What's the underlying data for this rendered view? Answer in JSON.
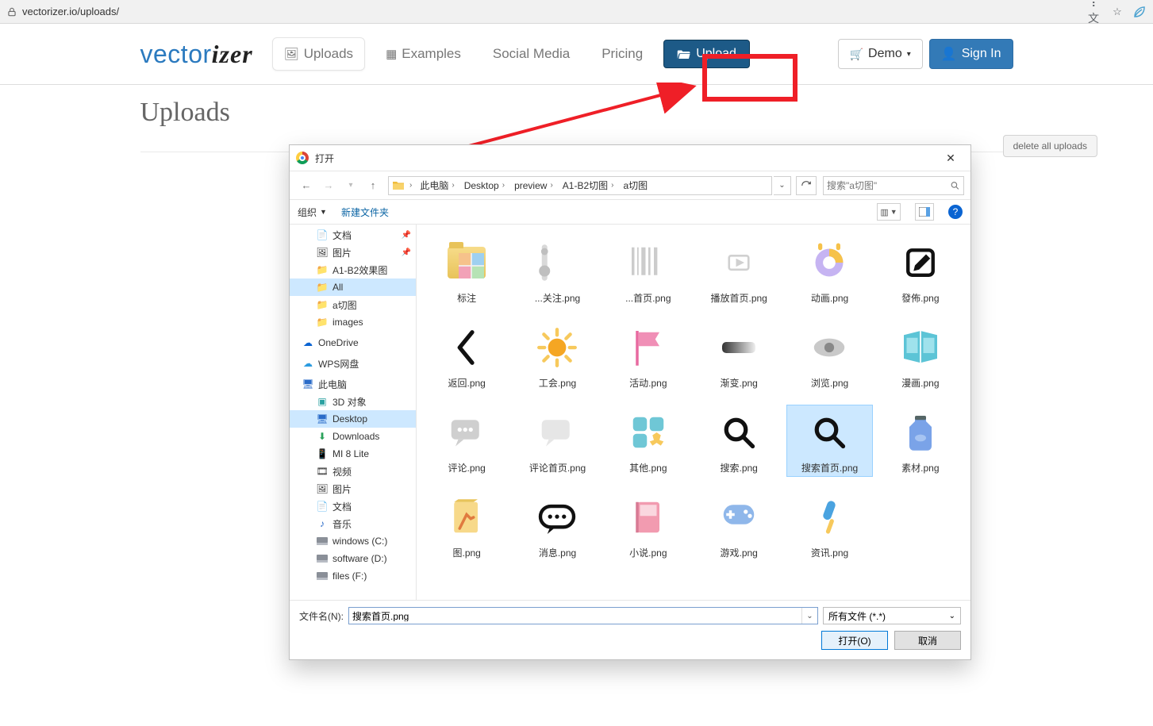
{
  "browser": {
    "url": "vectorizer.io/uploads/"
  },
  "nav": {
    "logo_vector": "vector",
    "logo_izer": "izer",
    "uploads": "Uploads",
    "examples": "Examples",
    "social": "Social Media",
    "pricing": "Pricing",
    "upload_btn": "Upload",
    "demo": "Demo",
    "signin": "Sign In"
  },
  "page_title": "Uploads",
  "delete_all": "delete all uploads",
  "dialog": {
    "title": "打开",
    "breadcrumb": [
      "此电脑",
      "Desktop",
      "preview",
      "A1-B2切图",
      "a切图"
    ],
    "search_placeholder": "搜索\"a切图\"",
    "organize": "组织",
    "new_folder": "新建文件夹",
    "help_tip": "?",
    "sidebar": {
      "docs": "文档",
      "pics": "图片",
      "f1": "A1-B2效果图",
      "f2": "All",
      "f3": "a切图",
      "f4": "images",
      "onedrive": "OneDrive",
      "wps": "WPS网盘",
      "thispc": "此电脑",
      "threed": "3D 对象",
      "desktop": "Desktop",
      "downloads": "Downloads",
      "mi8": "MI 8 Lite",
      "video": "视频",
      "pics2": "图片",
      "docs2": "文档",
      "music": "音乐",
      "cdrive": "windows (C:)",
      "ddrive": "software (D:)",
      "fdrive": "files (F:)"
    },
    "files": [
      {
        "name": "标注",
        "kind": "folder"
      },
      {
        "name": "...关注.png",
        "kind": "img",
        "svg": "speaker"
      },
      {
        "name": "...首页.png",
        "kind": "img",
        "svg": "barcode"
      },
      {
        "name": "播放首页.png",
        "kind": "img",
        "svg": "play"
      },
      {
        "name": "动画.png",
        "kind": "img",
        "svg": "donut"
      },
      {
        "name": "發佈.png",
        "kind": "img",
        "svg": "edit"
      },
      {
        "name": "返回.png",
        "kind": "img",
        "svg": "chevl"
      },
      {
        "name": "工会.png",
        "kind": "img",
        "svg": "sun"
      },
      {
        "name": "活动.png",
        "kind": "img",
        "svg": "flag"
      },
      {
        "name": "渐变.png",
        "kind": "img",
        "svg": "grad"
      },
      {
        "name": "浏览.png",
        "kind": "img",
        "svg": "eye"
      },
      {
        "name": "漫画.png",
        "kind": "img",
        "svg": "book"
      },
      {
        "name": "评论.png",
        "kind": "img",
        "svg": "bubble"
      },
      {
        "name": "评论首页.png",
        "kind": "img",
        "svg": "bubble2"
      },
      {
        "name": "其他.png",
        "kind": "img",
        "svg": "apps"
      },
      {
        "name": "搜索.png",
        "kind": "img",
        "svg": "magnify"
      },
      {
        "name": "搜索首页.png",
        "kind": "img",
        "svg": "magnify",
        "selected": true
      },
      {
        "name": "素材.png",
        "kind": "img",
        "svg": "jar"
      },
      {
        "name": "图.png",
        "kind": "img",
        "svg": "paper"
      },
      {
        "name": "消息.png",
        "kind": "img",
        "svg": "dots"
      },
      {
        "name": "小说.png",
        "kind": "img",
        "svg": "booklet"
      },
      {
        "name": "游戏.png",
        "kind": "img",
        "svg": "gamepad"
      },
      {
        "name": "资讯.png",
        "kind": "img",
        "svg": "mic"
      }
    ],
    "filename_label": "文件名(N):",
    "filename_value": "搜索首页.png",
    "filetype": "所有文件 (*.*)",
    "open_btn": "打开(O)",
    "cancel_btn": "取消"
  }
}
